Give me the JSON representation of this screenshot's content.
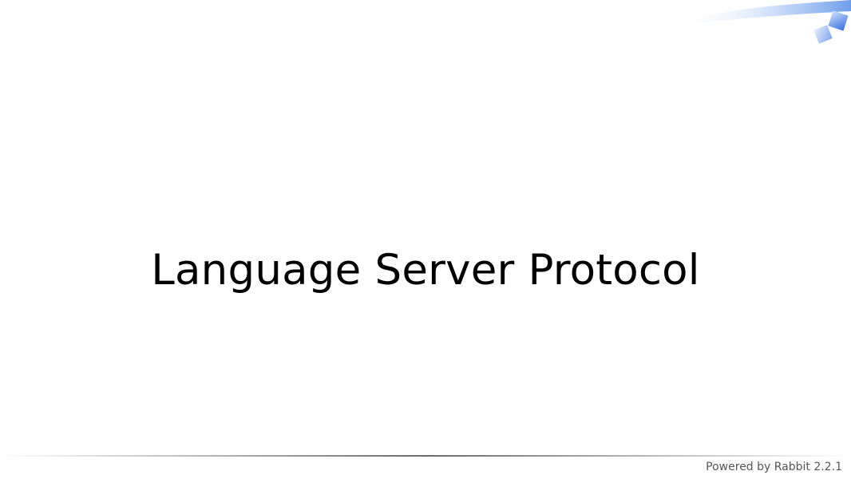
{
  "slide": {
    "title": "Language Server Protocol"
  },
  "footer": {
    "powered_by": "Powered by Rabbit 2.2.1"
  },
  "theme": {
    "accent_blue": "#3a6fe0",
    "light_blue": "#9ec0f5",
    "rule_color": "#7a7a7a",
    "footer_text_color": "#555555"
  }
}
